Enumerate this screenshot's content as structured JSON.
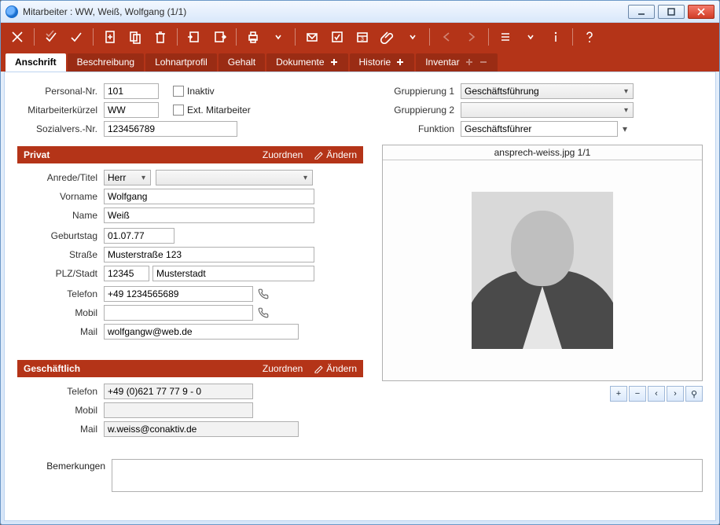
{
  "window": {
    "title": "Mitarbeiter : WW, Weiß, Wolfgang (1/1)"
  },
  "tabs": [
    {
      "label": "Anschrift",
      "active": true
    },
    {
      "label": "Beschreibung"
    },
    {
      "label": "Lohnartprofil"
    },
    {
      "label": "Gehalt"
    },
    {
      "label": "Dokumente",
      "plus": true
    },
    {
      "label": "Historie",
      "plus": true
    },
    {
      "label": "Inventar",
      "plus": true,
      "minus": true
    }
  ],
  "top_left": {
    "personal_nr_label": "Personal-Nr.",
    "personal_nr": "101",
    "inaktiv_label": "Inaktiv",
    "kuerzel_label": "Mitarbeiterkürzel",
    "kuerzel": "WW",
    "ext_label": "Ext. Mitarbeiter",
    "sv_label": "Sozialvers.-Nr.",
    "sv": "123456789"
  },
  "top_right": {
    "grp1_label": "Gruppierung 1",
    "grp1": "Geschäftsführung",
    "grp2_label": "Gruppierung 2",
    "grp2": "",
    "funktion_label": "Funktion",
    "funktion": "Geschäftsführer"
  },
  "privat": {
    "title": "Privat",
    "zuordnen": "Zuordnen",
    "aendern": "Ändern",
    "anrede_label": "Anrede/Titel",
    "anrede": "Herr",
    "titel": "",
    "vorname_label": "Vorname",
    "vorname": "Wolfgang",
    "name_label": "Name",
    "name": "Weiß",
    "geb_label": "Geburtstag",
    "geb": "01.07.77",
    "strasse_label": "Straße",
    "strasse": "Musterstraße 123",
    "plz_label": "PLZ/Stadt",
    "plz": "12345",
    "stadt": "Musterstadt",
    "tel_label": "Telefon",
    "tel": "+49 1234565689",
    "mobil_label": "Mobil",
    "mobil": "",
    "mail_label": "Mail",
    "mail": "wolfgangw@web.de"
  },
  "geschaeft": {
    "title": "Geschäftlich",
    "zuordnen": "Zuordnen",
    "aendern": "Ändern",
    "tel_label": "Telefon",
    "tel": "+49 (0)621 77 77 9 - 0",
    "mobil_label": "Mobil",
    "mobil": "",
    "mail_label": "Mail",
    "mail": "w.weiss@conaktiv.de"
  },
  "photo": {
    "caption": "ansprech-weiss.jpg 1/1"
  },
  "image_controls": {
    "add": "+",
    "remove": "−",
    "prev": "‹",
    "next": "›",
    "zoom": "⚲"
  },
  "remarks": {
    "label": "Bemerkungen",
    "value": ""
  }
}
